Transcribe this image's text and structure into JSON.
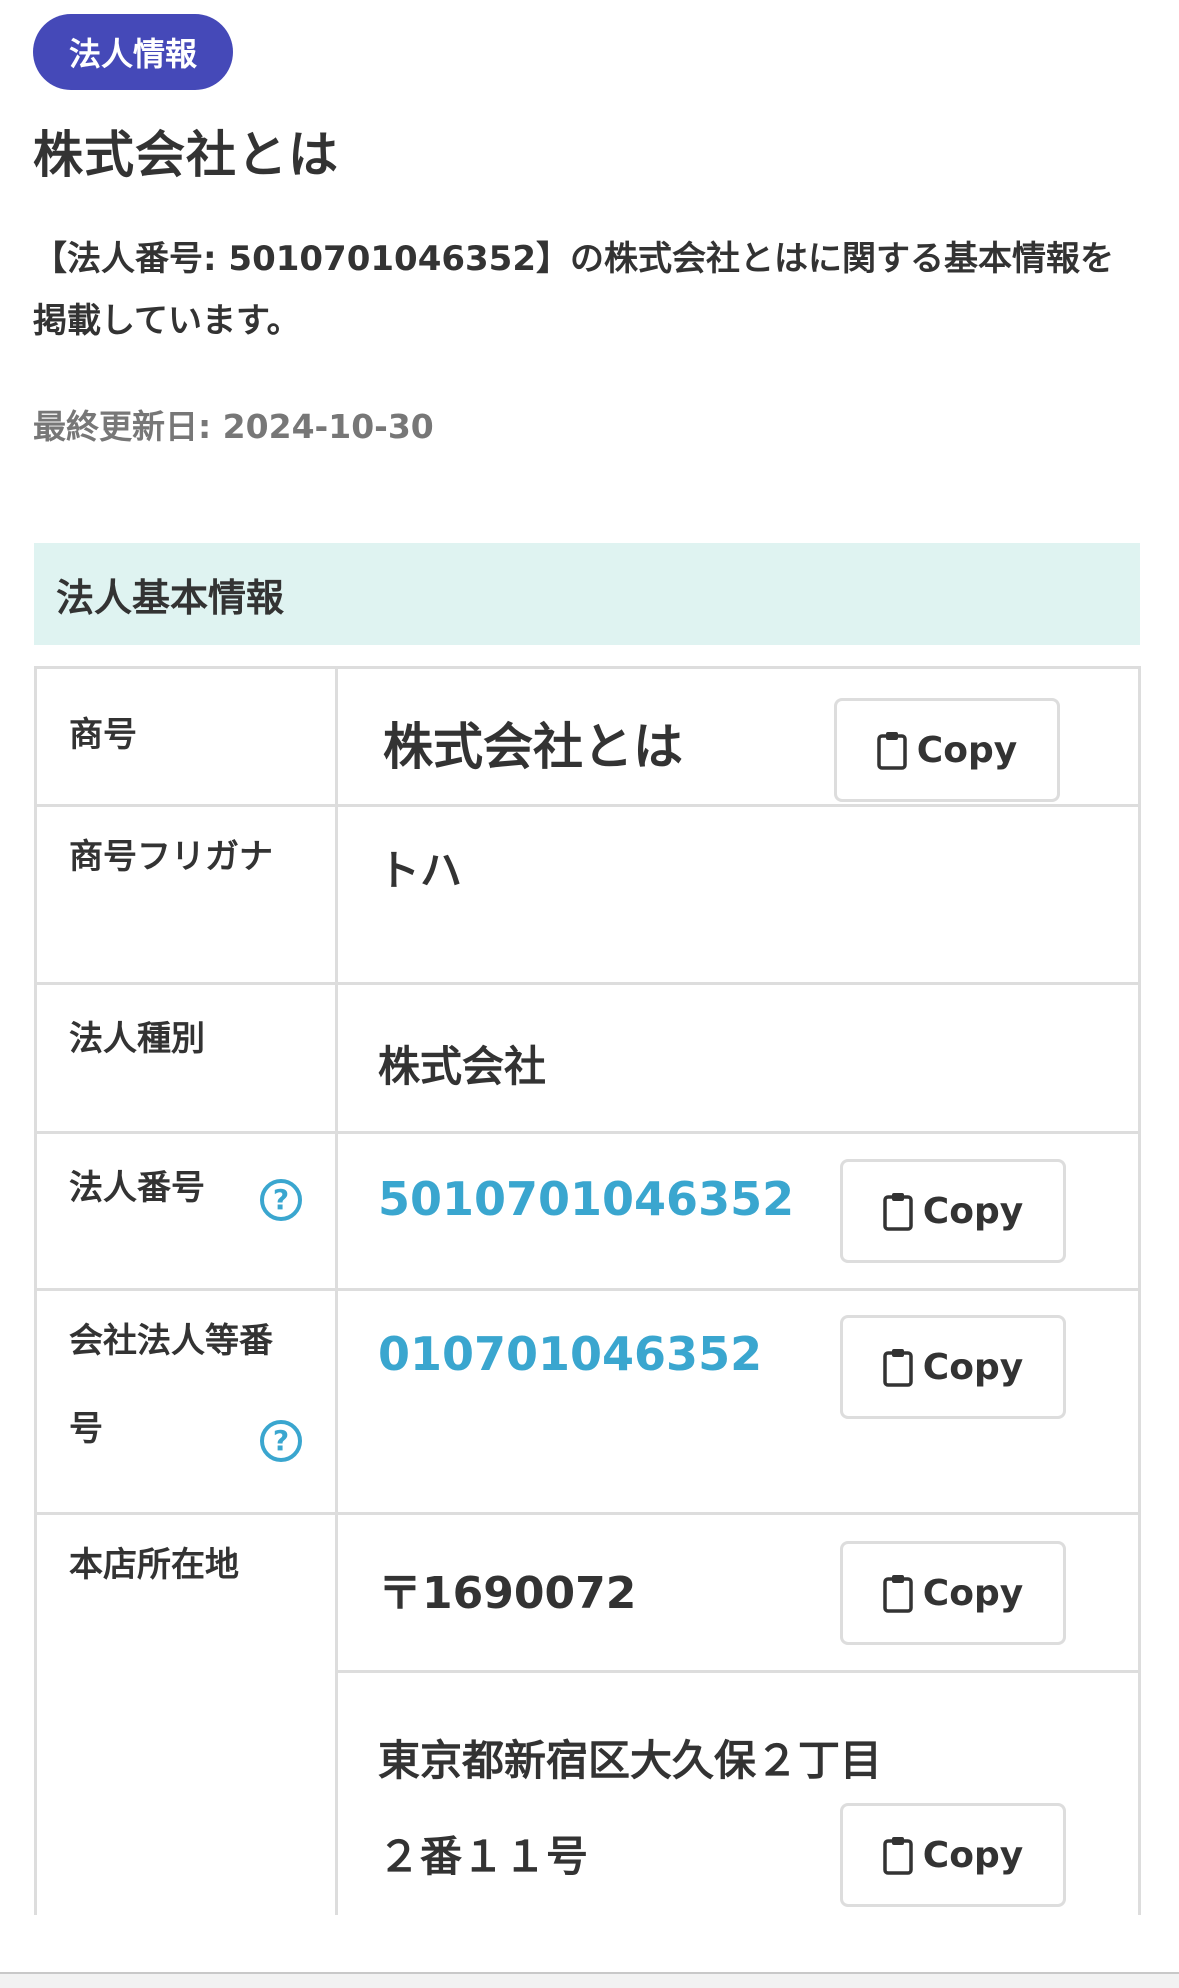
{
  "badge": {
    "label": "法人情報"
  },
  "page": {
    "title": "株式会社とは",
    "description": "【法人番号: 5010701046352】の株式会社とはに関する基本情報を掲載しています。",
    "last_updated": "最終更新日: 2024-10-30"
  },
  "section": {
    "title": "法人基本情報"
  },
  "copy_label": "Copy",
  "help_glyph": "?",
  "table": {
    "trade_name": {
      "label": "商号",
      "value": "株式会社とは"
    },
    "furigana": {
      "label": "商号フリガナ",
      "value": "トハ"
    },
    "corp_type": {
      "label": "法人種別",
      "value": "株式会社"
    },
    "corp_number": {
      "label": "法人番号",
      "value": "5010701046352"
    },
    "company_number": {
      "label": "会社法人等番号",
      "value": "010701046352"
    },
    "head_office": {
      "label": "本店所在地",
      "postal": "〒1690072",
      "address": "東京都新宿区大久保２丁目２番１１号"
    }
  },
  "colors": {
    "badge": "#4549B8",
    "section_bg": "#DFF3F1",
    "link": "#3AA6CF",
    "border": "#DDDDDD",
    "text": "#333333",
    "muted": "#777777"
  }
}
